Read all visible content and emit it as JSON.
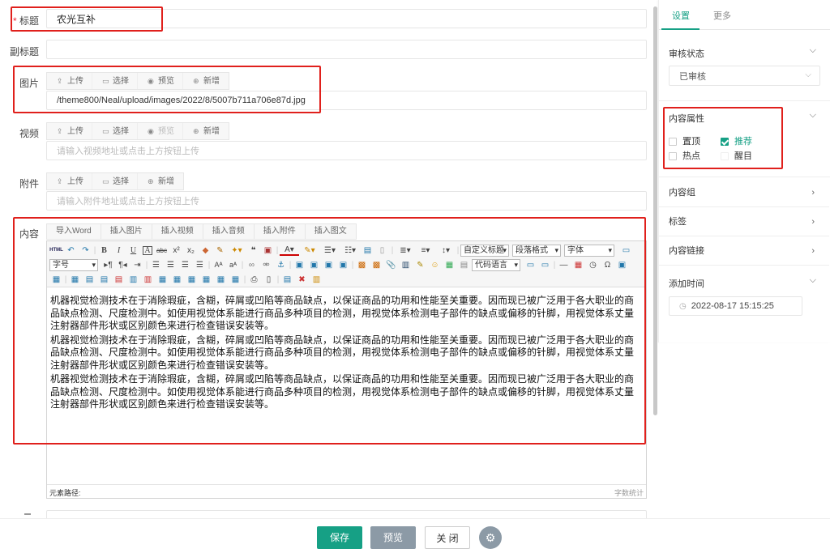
{
  "form": {
    "title": {
      "label": "标题",
      "required_mark": "*",
      "value": "农光互补"
    },
    "subtitle": {
      "label": "副标题",
      "value": ""
    },
    "image": {
      "label": "图片",
      "value": "/theme800/Neal/upload/images/2022/8/5007b711a706e87d.jpg"
    },
    "video": {
      "label": "视频",
      "placeholder": "请输入视频地址或点击上方按钮上传"
    },
    "attachment": {
      "label": "附件",
      "placeholder": "请输入附件地址或点击上方按钮上传"
    },
    "content": {
      "label": "内容"
    }
  },
  "upload_buttons": {
    "upload": "上传",
    "select": "选择",
    "preview": "预览",
    "add": "新增"
  },
  "insert_tabs": [
    "导入Word",
    "插入图片",
    "插入视频",
    "插入音频",
    "插入附件",
    "插入图文"
  ],
  "toolbar": {
    "html": "HTML",
    "custom_title": "自定义标题",
    "paragraph_format": "段落格式",
    "font_family": "字体",
    "font_size": "字号",
    "code_language": "代码语言"
  },
  "editor": {
    "paragraphs": [
      "机器视觉检测技术在于消除瑕疵，含糊，碎屑或凹陷等商品缺点，以保证商品的功用和性能至关重要。因而现已被广泛用于各大职业的商品缺点检测、尺度检测中。如使用视觉体系能进行商品多种项目的检测，用视觉体系检测电子部件的缺点或偏移的针脚，用视觉体系丈量注射器部件形状或区别颜色来进行检查错误安装等。",
      "机器视觉检测技术在于消除瑕疵，含糊，碎屑或凹陷等商品缺点，以保证商品的功用和性能至关重要。因而现已被广泛用于各大职业的商品缺点检测、尺度检测中。如使用视觉体系能进行商品多种项目的检测，用视觉体系检测电子部件的缺点或偏移的针脚，用视觉体系丈量注射器部件形状或区别颜色来进行检查错误安装等。",
      "机器视觉检测技术在于消除瑕疵，含糊，碎屑或凹陷等商品缺点，以保证商品的功用和性能至关重要。因而现已被广泛用于各大职业的商品缺点检测、尺度检测中。如使用视觉体系能进行商品多种项目的检测，用视觉体系检测电子部件的缺点或偏移的针脚，用视觉体系丈量注射器部件形状或区别颜色来进行检查错误安装等。"
    ],
    "element_path": "元素路径:",
    "word_count": "字数统计"
  },
  "sidebar": {
    "tabs": [
      "设置",
      "更多"
    ],
    "review_status": {
      "label": "审核状态",
      "value": "已审核"
    },
    "attributes": {
      "label": "内容属性",
      "items": [
        {
          "label": "置顶",
          "checked": false
        },
        {
          "label": "推荐",
          "checked": true
        },
        {
          "label": "热点",
          "checked": false
        },
        {
          "label": "醒目",
          "checked": false
        }
      ]
    },
    "content_group": "内容组",
    "tags": "标签",
    "content_link": "内容链接",
    "add_time": {
      "label": "添加时间",
      "value": "2022-08-17 15:15:25"
    }
  },
  "footer": {
    "save": "保存",
    "preview": "预览",
    "close": "关 闭"
  },
  "colors": {
    "accent": "#16a085",
    "highlight": "#e0201c",
    "preview_btn": "#8c9aa6"
  }
}
